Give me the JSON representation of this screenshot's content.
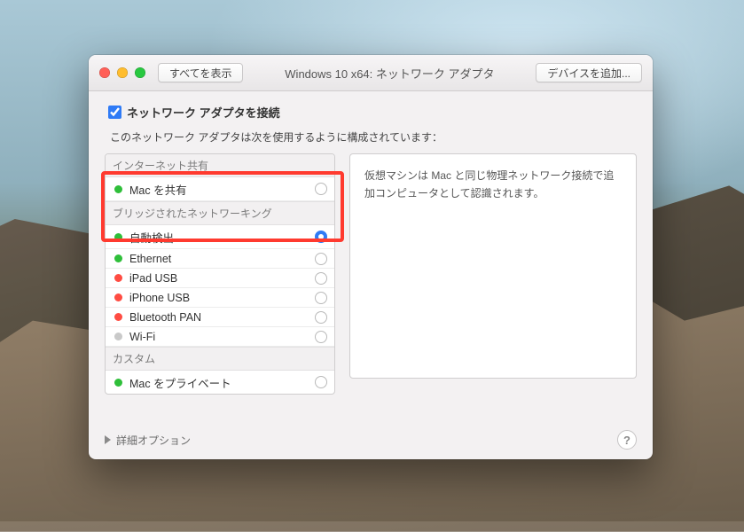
{
  "header": {
    "show_all_label": "すべてを表示",
    "title": "Windows 10 x64: ネットワーク アダプタ",
    "add_device_label": "デバイスを追加..."
  },
  "main_checkbox": {
    "label": "ネットワーク アダプタを接続",
    "checked": true
  },
  "description": "このネットワーク アダプタは次を使用するように構成されています：",
  "groups": [
    {
      "title": "インターネット共有",
      "items": [
        {
          "status": "grn",
          "label": "Mac を共有",
          "selected": false
        }
      ]
    },
    {
      "title": "ブリッジされたネットワーキング",
      "items": [
        {
          "status": "grn",
          "label": "自動検出",
          "selected": true
        },
        {
          "status": "grn",
          "label": "Ethernet",
          "selected": false
        },
        {
          "status": "red",
          "label": "iPad USB",
          "selected": false
        },
        {
          "status": "red",
          "label": "iPhone USB",
          "selected": false
        },
        {
          "status": "red",
          "label": "Bluetooth PAN",
          "selected": false
        },
        {
          "status": "gry",
          "label": "Wi-Fi",
          "selected": false
        }
      ]
    },
    {
      "title": "カスタム",
      "items": [
        {
          "status": "grn",
          "label": "Mac をプライベート",
          "selected": false
        }
      ]
    }
  ],
  "info_panel": "仮想マシンは Mac と同じ物理ネットワーク接続で追加コンピュータとして認識されます。",
  "advanced_label": "詳細オプション",
  "help_label": "?"
}
